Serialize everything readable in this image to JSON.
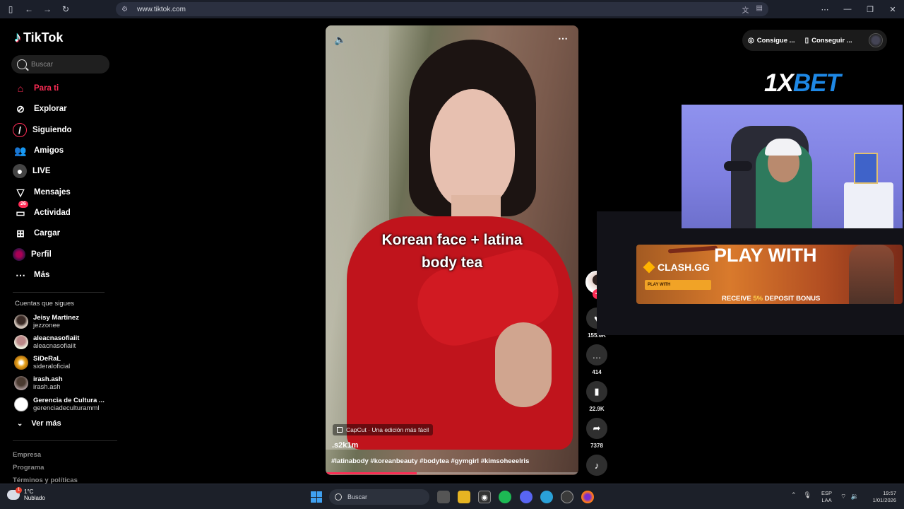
{
  "browser": {
    "url": "www.tiktok.com",
    "icons": [
      "sidebar-icon",
      "back-icon",
      "forward-icon",
      "reload-icon",
      "site-info-icon",
      "translate-icon",
      "reader-icon",
      "more-icon",
      "minimize-icon",
      "restore-icon",
      "close-icon"
    ]
  },
  "sidebar": {
    "logo_text": "TikTok",
    "search_placeholder": "Buscar",
    "nav": [
      {
        "label": "Para ti",
        "icon": "home-icon",
        "active": true
      },
      {
        "label": "Explorar",
        "icon": "compass-icon"
      },
      {
        "label": "Siguiendo",
        "icon": "following-icon"
      },
      {
        "label": "Amigos",
        "icon": "friends-icon"
      },
      {
        "label": "LIVE",
        "icon": "live-icon"
      },
      {
        "label": "Mensajes",
        "icon": "messages-icon"
      },
      {
        "label": "Actividad",
        "icon": "activity-icon",
        "badge": "26"
      },
      {
        "label": "Cargar",
        "icon": "upload-icon"
      },
      {
        "label": "Perfil",
        "icon": "profile-icon"
      },
      {
        "label": "Más",
        "icon": "more-icon"
      }
    ],
    "following_heading": "Cuentas que sigues",
    "following": [
      {
        "name": "Jeisy Martinez",
        "username": "jezzonee"
      },
      {
        "name": "aleacnasofiaiit",
        "username": "aleacnasofiaiit"
      },
      {
        "name": "SiDeRaL",
        "username": "sideraloficial"
      },
      {
        "name": "irash.ash",
        "username": "irash.ash"
      },
      {
        "name": "Gerencia de Cultura ...",
        "username": "gerenciadeculturamml"
      }
    ],
    "see_more": "Ver más",
    "footer": [
      "Empresa",
      "Programa",
      "Términos y políticas"
    ]
  },
  "video": {
    "caption_line1": "Korean face + latina",
    "caption_line2": "body tea",
    "capcut_label": "CapCut · Una edición más fácil",
    "author": ".s2k1m",
    "hashtags": "#latinabody #koreanbeauty #bodytea #gymgirl #kimsoheeelris",
    "progress": 0.36
  },
  "actions": {
    "likes": "155.6K",
    "comments": "414",
    "saves": "22.9K",
    "shares": "7378"
  },
  "top_right": {
    "btn1": "Consigue ...",
    "btn2": "Conseguir ..."
  },
  "overlay": {
    "brand_1x": "1X",
    "brand_bet": "BET",
    "clash_headline": "PLAY WITH",
    "clash_logo": "CLASH.GG",
    "clash_button": "PLAY WITH",
    "clash_receive_a": "RECEIVE ",
    "clash_receive_b": "5%",
    "clash_receive_c": " DEPOSIT BONUS"
  },
  "taskbar": {
    "weather_temp": "1°C",
    "weather_desc": "Nublado",
    "weather_badge": "1",
    "search_placeholder": "Buscar",
    "lang_1": "ESP",
    "lang_2": "LAA",
    "time": "19:57",
    "date": "1/01/2026"
  },
  "colors": {
    "accent": "#fe2c55",
    "tiktok_cyan": "#25f4ee",
    "bet_blue": "#1e88e5"
  }
}
